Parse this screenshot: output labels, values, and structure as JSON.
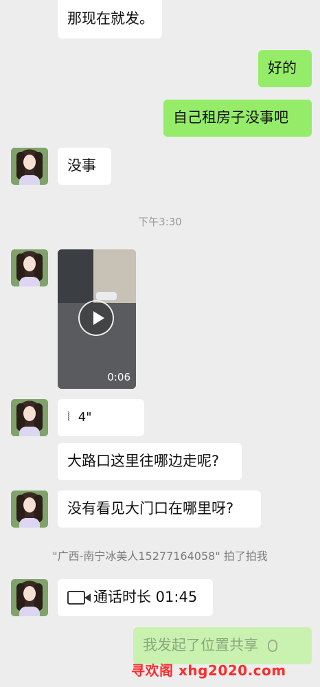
{
  "messages": {
    "m1": "那现在就发。",
    "m2": "好的",
    "m3": "自己租房子没事吧",
    "m4": "没事",
    "time_divider": "下午3:30",
    "video_duration": "0:06",
    "voice_duration": "4\"",
    "m5": "大路口这里往哪边走呢?",
    "m6": "没有看见大门口在哪里呀?",
    "system_pat": "\"广西-南宁冰美人15277164058\" 拍了拍我",
    "call": "通话时长 01:45",
    "location_share": "我发起了位置共享"
  },
  "watermark": "寻欢阁 xhg2020.com",
  "colors": {
    "background": "#ededed",
    "my_bubble": "#95ec69",
    "their_bubble": "#ffffff",
    "watermark": "#ff2b2b"
  },
  "icons": [
    "video-play-icon",
    "voice-wave-icon",
    "video-call-icon",
    "location-pin-icon"
  ]
}
